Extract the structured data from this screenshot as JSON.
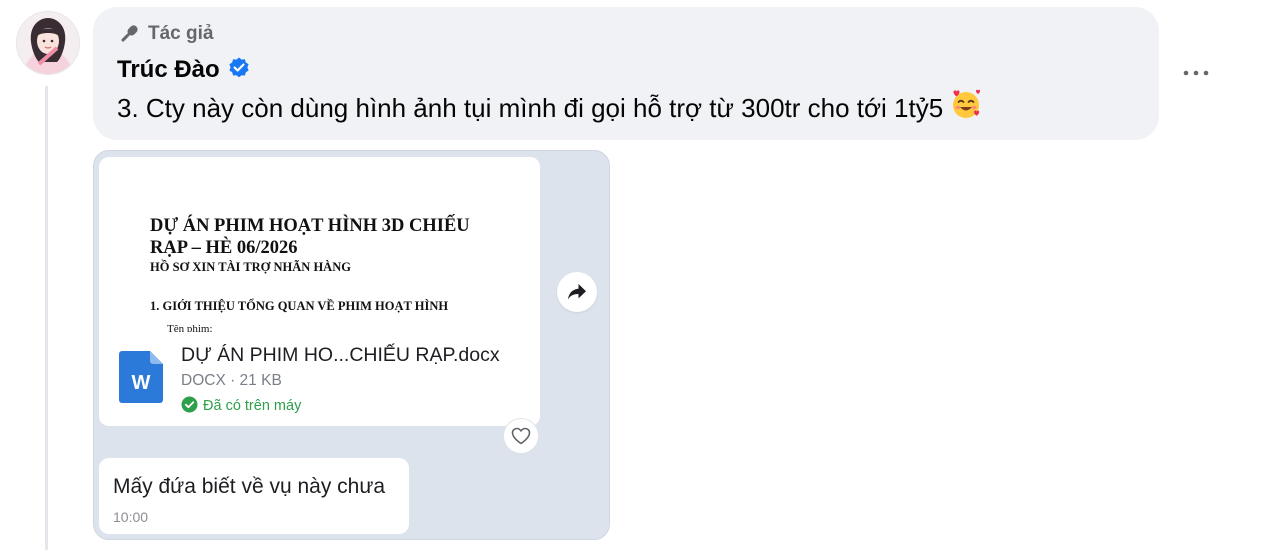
{
  "comment": {
    "badge_label": "Tác giả",
    "author_name": "Trúc Đào",
    "text": "3. Cty này còn dùng hình ảnh tụi mình đi gọi hỗ trợ từ 300tr cho tới 1tỷ5",
    "emoji": "🥰",
    "verified_color": "#1877f2"
  },
  "attachment": {
    "document_preview": {
      "title": "DỰ ÁN PHIM HOẠT HÌNH 3D CHIẾU RẠP – HÈ 06/2026",
      "subtitle": "HỒ SƠ XIN TÀI TRỢ NHÃN HÀNG",
      "section": "1. GIỚI THIỆU TỔNG QUAN VỀ PHIM HOẠT HÌNH",
      "cut_line": "Tên phim:"
    },
    "file": {
      "icon_letter": "W",
      "name": "DỰ ÁN PHIM HO...CHIẾU RẠP.docx",
      "meta": "DOCX · 21 KB",
      "status": "Đã có trên máy",
      "status_color": "#2e9f4b",
      "icon_color": "#2b79d8"
    },
    "message": {
      "text": "Mấy đứa biết về vụ này chưa",
      "time": "10:00"
    }
  }
}
